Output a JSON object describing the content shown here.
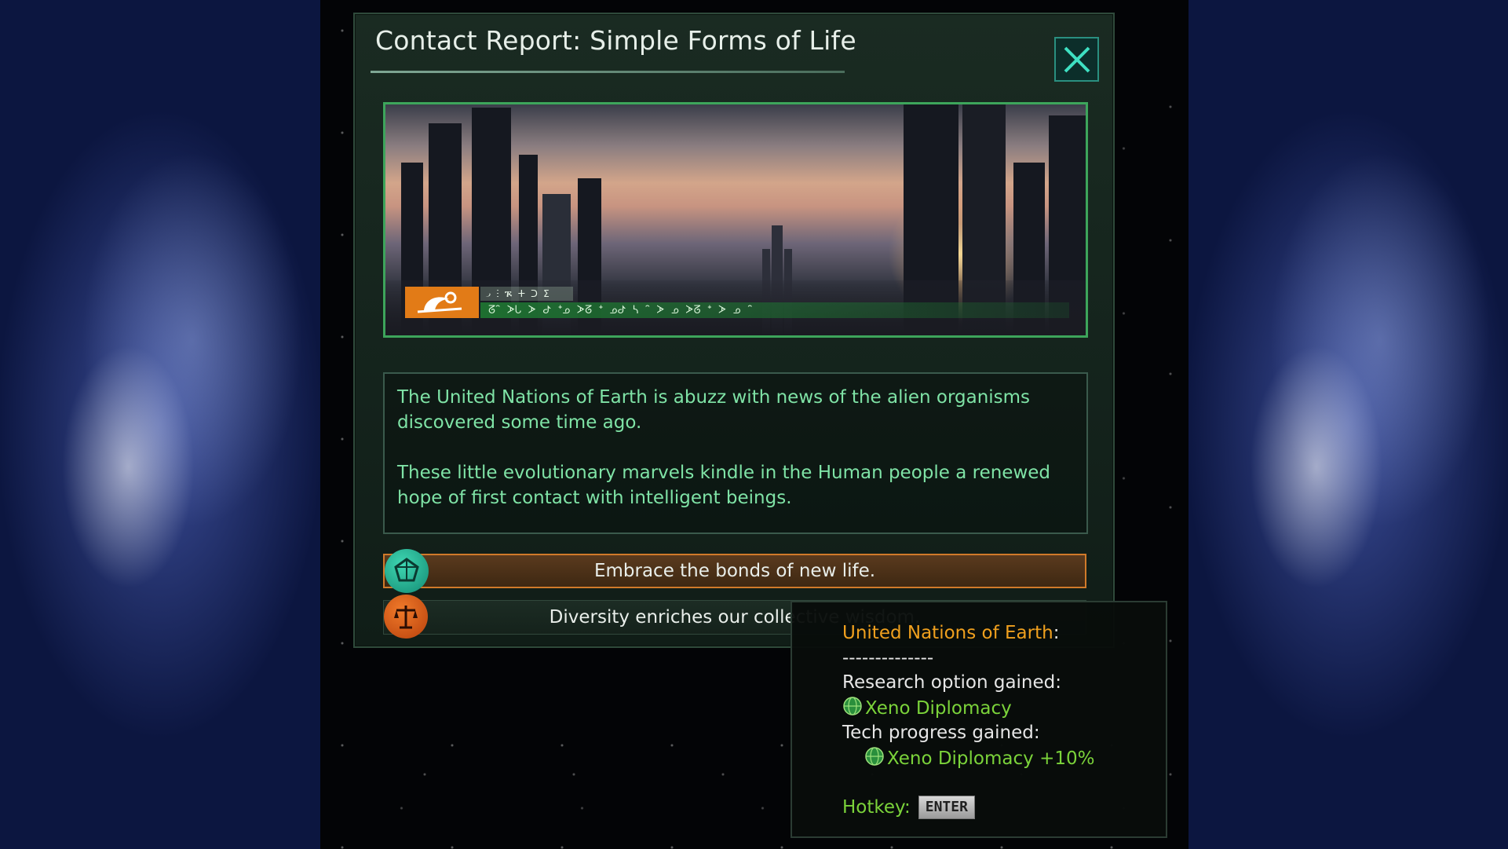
{
  "dialog": {
    "title": "Contact Report: Simple Forms of Life",
    "hud_code": "᎕ ⵗ ᎍ ⵜ ᑐ ⵉ",
    "hud_glyphs": "ᘔᐢ ᗆᒐ ᗆ ᕷ ᐩᓄ ᗆᘔ ᐩ ᓄᕷ ᓴ ᐢ ᗆ ᓄ ᗆᘔ ᐩ ᗆ ᓄ ᐢ",
    "description": [
      "The United Nations of Earth is abuzz with news of the alien organisms discovered some time ago.",
      "These little evolutionary marvels kindle in the Human people a renewed hope of first contact with intelligent beings."
    ],
    "options": [
      {
        "label": "Embrace the bonds of new life.",
        "icon": "xenophile-ethic-icon",
        "selected": true
      },
      {
        "label": "Diversity enriches our collective wisdom.",
        "icon": "egalitarian-scales-icon",
        "selected": false
      }
    ]
  },
  "tooltip": {
    "empire": "United Nations of Earth",
    "colon": ":",
    "separator": "--------------",
    "research_label": "Research option gained:",
    "research_item": "Xeno Diplomacy",
    "progress_label": "Tech progress gained:",
    "progress_item": "Xeno Diplomacy",
    "progress_value": "+10%",
    "hotkey_label": "Hotkey:",
    "hotkey_key": "ENTER"
  },
  "colors": {
    "accent_green": "#7fe3a6",
    "frame_green": "#3da55b",
    "selected_orange": "#d07a2a",
    "empire_orange": "#f0a01e",
    "tech_green": "#7bd33a"
  }
}
